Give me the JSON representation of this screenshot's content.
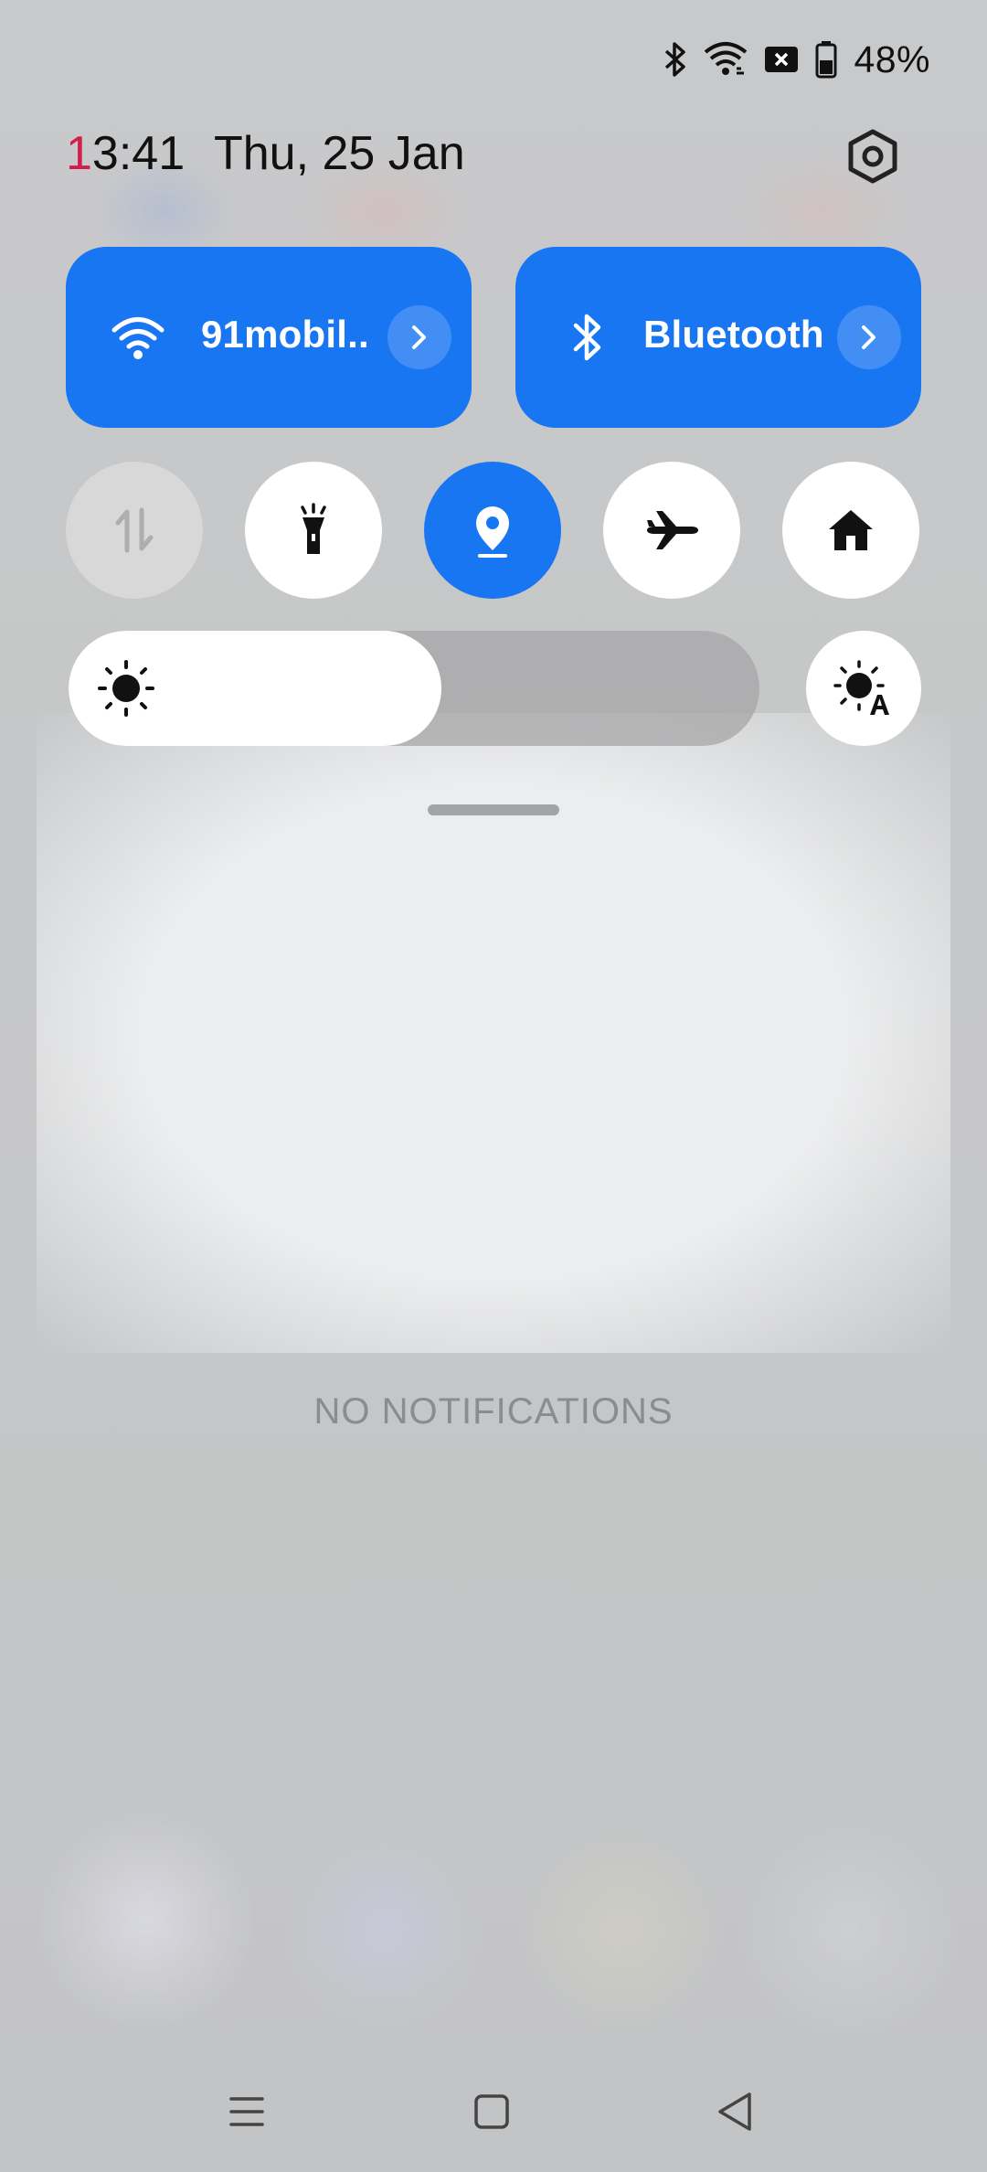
{
  "status_bar": {
    "icons": [
      "bluetooth-icon",
      "wifi-icon",
      "no-sim-icon",
      "battery-icon"
    ],
    "battery_percent": "48%"
  },
  "header": {
    "time_first_digit": "1",
    "time_rest": "3:41",
    "date": "Thu, 25 Jan",
    "settings_icon": "gear-icon"
  },
  "tiles": {
    "wifi": {
      "label": "91mobil..",
      "icon": "wifi-icon",
      "active": true
    },
    "bluetooth": {
      "label": "Bluetooth",
      "icon": "bluetooth-icon",
      "active": true
    }
  },
  "toggles": [
    {
      "name": "mobile-data",
      "icon": "data-transfer-icon",
      "state": "disabled"
    },
    {
      "name": "flashlight",
      "icon": "flashlight-icon",
      "state": "off"
    },
    {
      "name": "location",
      "icon": "location-pin-icon",
      "state": "on"
    },
    {
      "name": "airplane-mode",
      "icon": "airplane-icon",
      "state": "off"
    },
    {
      "name": "home",
      "icon": "home-icon",
      "state": "off"
    }
  ],
  "brightness": {
    "level_fraction": 0.54,
    "auto_icon": "auto-brightness-icon"
  },
  "notifications": {
    "empty_text": "NO NOTIFICATIONS"
  },
  "nav_bar": [
    "recents-menu-icon",
    "home-square-icon",
    "back-triangle-icon"
  ],
  "colors": {
    "accent": "#1976f2",
    "clock_accent": "#d21e4a"
  }
}
